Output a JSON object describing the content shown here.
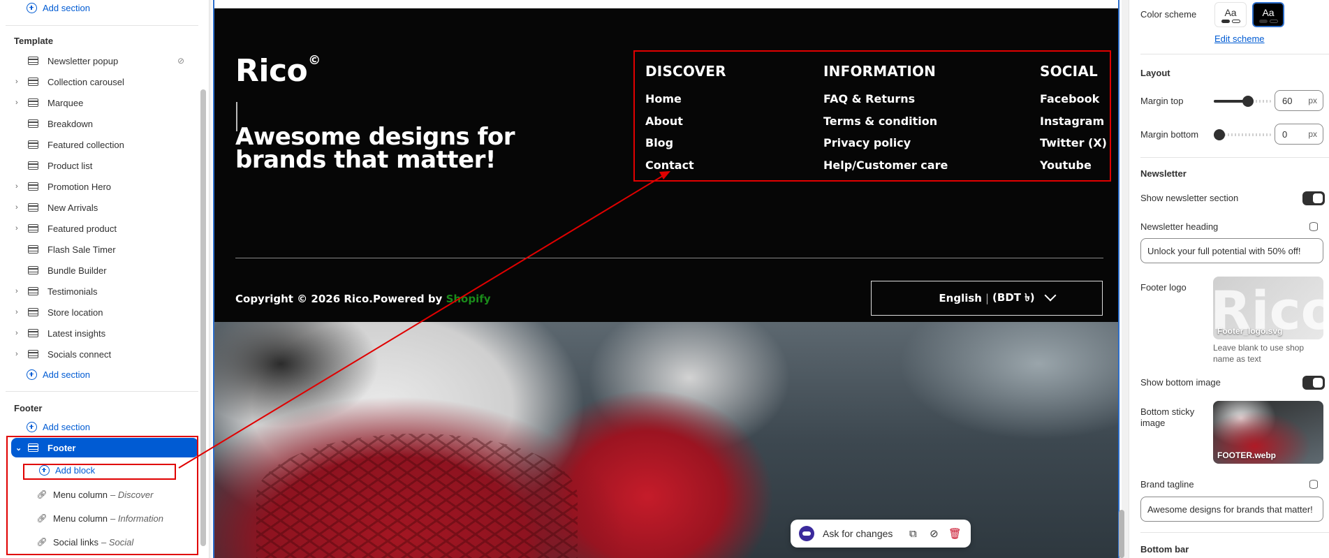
{
  "sidebar": {
    "top_add_section": "Add section",
    "template_heading": "Template",
    "template_items": [
      {
        "label": "Newsletter popup",
        "expandable": false,
        "hidden": true
      },
      {
        "label": "Collection carousel",
        "expandable": true
      },
      {
        "label": "Marquee",
        "expandable": true
      },
      {
        "label": "Breakdown",
        "expandable": false
      },
      {
        "label": "Featured collection",
        "expandable": false
      },
      {
        "label": "Product list",
        "expandable": false
      },
      {
        "label": "Promotion Hero",
        "expandable": true
      },
      {
        "label": "New Arrivals",
        "expandable": true
      },
      {
        "label": "Featured product",
        "expandable": true
      },
      {
        "label": "Flash Sale Timer",
        "expandable": false
      },
      {
        "label": "Bundle Builder",
        "expandable": false
      },
      {
        "label": "Testimonials",
        "expandable": true
      },
      {
        "label": "Store location",
        "expandable": true
      },
      {
        "label": "Latest insights",
        "expandable": true
      },
      {
        "label": "Socials connect",
        "expandable": true
      }
    ],
    "template_add_section": "Add section",
    "footer_heading": "Footer",
    "footer_add_section": "Add section",
    "footer_section": "Footer",
    "add_block": "Add block",
    "blocks": [
      {
        "name": "Menu column",
        "detail": "– Discover"
      },
      {
        "name": "Menu column",
        "detail": "– Information"
      },
      {
        "name": "Social links",
        "detail": "– Social"
      }
    ]
  },
  "preview": {
    "logo": "Rico",
    "logo_mark": "©",
    "tagline": "Awesome designs for brands that matter!",
    "menus": [
      {
        "title": "DISCOVER",
        "links": [
          "Home",
          "About",
          "Blog",
          "Contact"
        ]
      },
      {
        "title": "INFORMATION",
        "links": [
          "FAQ & Returns",
          "Terms & condition",
          "Privacy policy",
          "Help/Customer care"
        ]
      },
      {
        "title": "SOCIAL",
        "links": [
          "Facebook",
          "Instagram",
          "Twitter (X)",
          "Youtube"
        ]
      }
    ],
    "copyright": "Copyright © 2026 Rico.Powered by",
    "copyright_link": "Shopify",
    "language": "English",
    "currency": "(BDT ৳)",
    "toolbar": {
      "ask_label": "Ask for changes",
      "icons": [
        "duplicate-icon",
        "hide-icon",
        "delete-icon"
      ]
    }
  },
  "settings": {
    "color_scheme_label": "Color scheme",
    "scheme_sample": "Aa",
    "edit_scheme": "Edit scheme",
    "layout_heading": "Layout",
    "margin_top_label": "Margin top",
    "margin_top_value": "60",
    "margin_top_fraction": 0.6,
    "margin_bottom_label": "Margin bottom",
    "margin_bottom_value": "0",
    "margin_bottom_fraction": 0,
    "unit": "px",
    "newsletter_heading": "Newsletter",
    "show_newsletter_label": "Show newsletter section",
    "show_newsletter": true,
    "newsletter_heading_label": "Newsletter heading",
    "newsletter_heading_value": "Unlock your full potential with 50% off!",
    "footer_logo_label": "Footer logo",
    "footer_logo_file": "Footer_logo.svg",
    "footer_logo_watermark": "Rico",
    "footer_logo_help": "Leave blank to use shop name as text",
    "show_bottom_image_label": "Show bottom image",
    "show_bottom_image": true,
    "bottom_sticky_image_label": "Bottom sticky image",
    "bottom_sticky_image_file": "FOOTER.webp",
    "brand_tagline_label": "Brand tagline",
    "brand_tagline_value": "Awesome designs for brands that matter!",
    "bottom_bar_heading": "Bottom bar"
  },
  "colors": {
    "accent": "#005bd3",
    "annotation": "#e00000",
    "footer_bg": "#060606",
    "shopify_green": "#1a8a1a"
  }
}
